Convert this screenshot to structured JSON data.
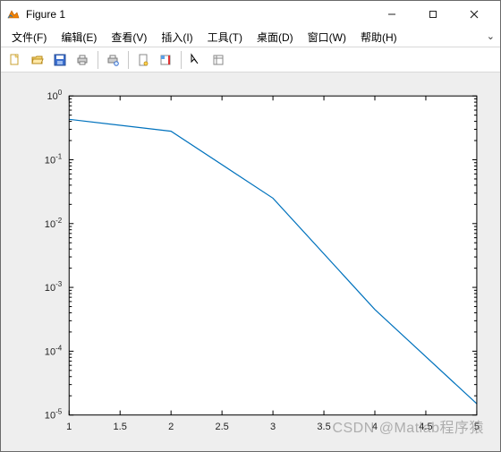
{
  "window": {
    "title": "Figure 1",
    "buttons": {
      "minimize": "–",
      "maximize": "▢",
      "close": "✕"
    }
  },
  "menu": {
    "items": [
      {
        "label": "文件(F)"
      },
      {
        "label": "编辑(E)"
      },
      {
        "label": "查看(V)"
      },
      {
        "label": "插入(I)"
      },
      {
        "label": "工具(T)"
      },
      {
        "label": "桌面(D)"
      },
      {
        "label": "窗口(W)"
      },
      {
        "label": "帮助(H)"
      }
    ],
    "dropdown_symbol": "⌄"
  },
  "toolbar": {
    "buttons": [
      {
        "name": "new-figure-icon"
      },
      {
        "name": "open-icon"
      },
      {
        "name": "save-icon"
      },
      {
        "name": "print-icon"
      },
      {
        "sep": true
      },
      {
        "name": "print-preview-icon"
      },
      {
        "sep": true
      },
      {
        "name": "link-data-icon"
      },
      {
        "name": "colorbar-icon"
      },
      {
        "sep": true
      },
      {
        "name": "edit-plot-icon"
      },
      {
        "name": "open-property-inspector-icon"
      }
    ]
  },
  "watermark": "CSDN @Matlab程序猿",
  "chart_data": {
    "type": "line",
    "x": [
      1,
      2,
      3,
      4,
      5
    ],
    "y": [
      0.43,
      0.28,
      0.025,
      0.00045,
      1.5e-05
    ],
    "xlim": [
      1,
      5
    ],
    "ylim": [
      1e-05,
      1
    ],
    "yscale": "log",
    "xticks": [
      1,
      1.5,
      2,
      2.5,
      3,
      3.5,
      4,
      4.5,
      5
    ],
    "yticks": [
      1e-05,
      0.0001,
      0.001,
      0.01,
      0.1,
      1
    ],
    "ytick_labels": [
      "10^-5",
      "10^-4",
      "10^-3",
      "10^-2",
      "10^-1",
      "10^0"
    ],
    "line_color": "#0072BD",
    "title": "",
    "xlabel": "",
    "ylabel": ""
  }
}
